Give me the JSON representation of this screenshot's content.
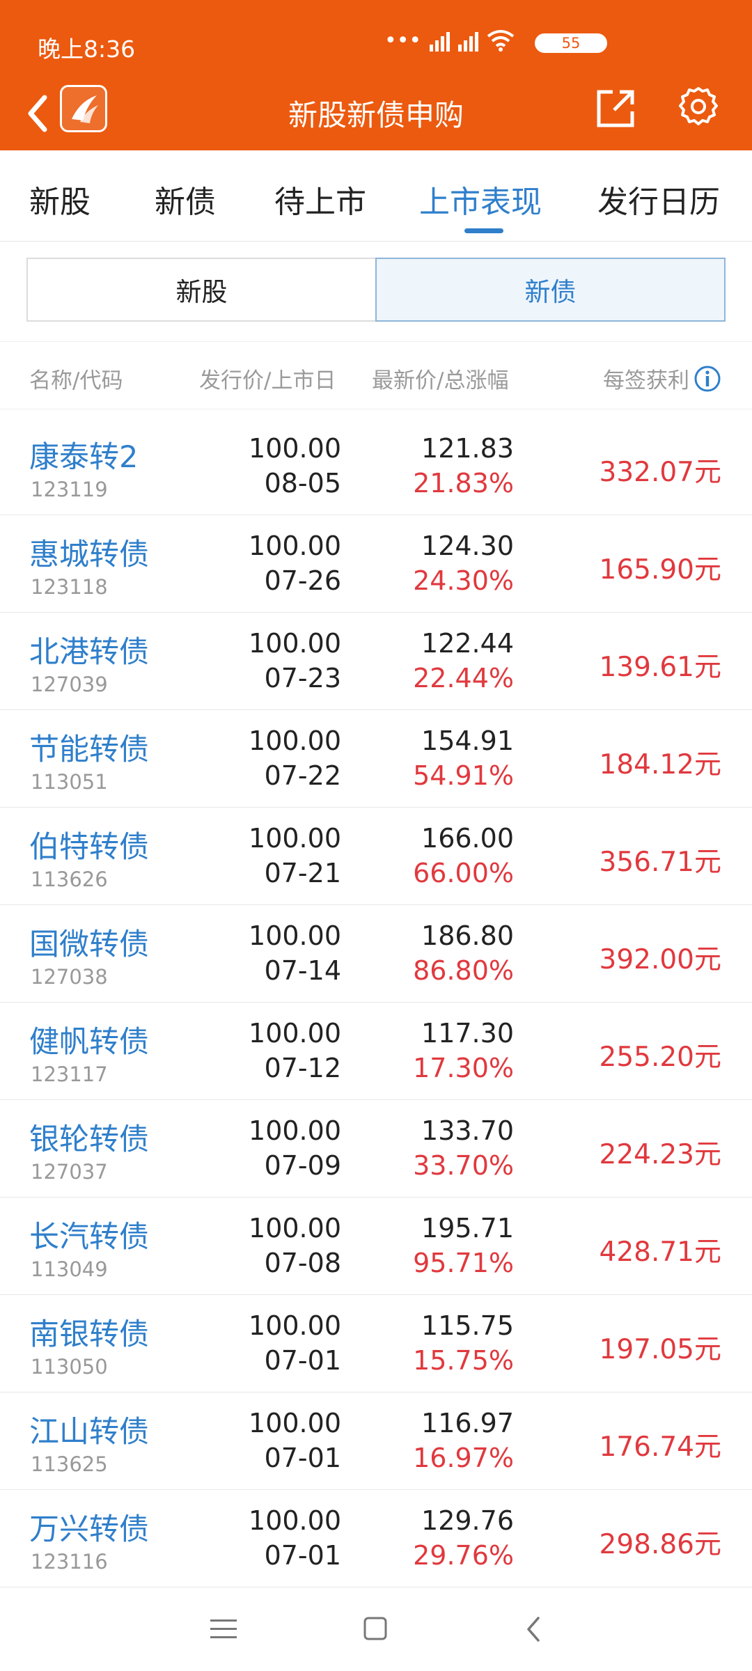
{
  "status_bar": {
    "time": "晚上8:36",
    "battery": "55"
  },
  "header": {
    "title": "新股新债申购"
  },
  "tabs": [
    {
      "label": "新股"
    },
    {
      "label": "新债"
    },
    {
      "label": "待上市"
    },
    {
      "label": "上市表现",
      "active": true
    },
    {
      "label": "发行日历"
    }
  ],
  "segment": {
    "left_label": "新股",
    "right_label": "新债",
    "selected": "新债"
  },
  "columns": {
    "name_code": "名称/代码",
    "issue_date": "发行价/上市日",
    "price_change": "最新价/总涨幅",
    "profit": "每签获利"
  },
  "rows": [
    {
      "name": "康泰转2",
      "code": "123119",
      "issue": "100.00",
      "date": "08-05",
      "price": "121.83",
      "change": "21.83%",
      "profit": "332.07元"
    },
    {
      "name": "惠城转债",
      "code": "123118",
      "issue": "100.00",
      "date": "07-26",
      "price": "124.30",
      "change": "24.30%",
      "profit": "165.90元"
    },
    {
      "name": "北港转债",
      "code": "127039",
      "issue": "100.00",
      "date": "07-23",
      "price": "122.44",
      "change": "22.44%",
      "profit": "139.61元"
    },
    {
      "name": "节能转债",
      "code": "113051",
      "issue": "100.00",
      "date": "07-22",
      "price": "154.91",
      "change": "54.91%",
      "profit": "184.12元"
    },
    {
      "name": "伯特转债",
      "code": "113626",
      "issue": "100.00",
      "date": "07-21",
      "price": "166.00",
      "change": "66.00%",
      "profit": "356.71元"
    },
    {
      "name": "国微转债",
      "code": "127038",
      "issue": "100.00",
      "date": "07-14",
      "price": "186.80",
      "change": "86.80%",
      "profit": "392.00元"
    },
    {
      "name": "健帆转债",
      "code": "123117",
      "issue": "100.00",
      "date": "07-12",
      "price": "117.30",
      "change": "17.30%",
      "profit": "255.20元"
    },
    {
      "name": "银轮转债",
      "code": "127037",
      "issue": "100.00",
      "date": "07-09",
      "price": "133.70",
      "change": "33.70%",
      "profit": "224.23元"
    },
    {
      "name": "长汽转债",
      "code": "113049",
      "issue": "100.00",
      "date": "07-08",
      "price": "195.71",
      "change": "95.71%",
      "profit": "428.71元"
    },
    {
      "name": "南银转债",
      "code": "113050",
      "issue": "100.00",
      "date": "07-01",
      "price": "115.75",
      "change": "15.75%",
      "profit": "197.05元"
    },
    {
      "name": "江山转债",
      "code": "113625",
      "issue": "100.00",
      "date": "07-01",
      "price": "116.97",
      "change": "16.97%",
      "profit": "176.74元"
    },
    {
      "name": "万兴转债",
      "code": "123116",
      "issue": "100.00",
      "date": "07-01",
      "price": "129.76",
      "change": "29.76%",
      "profit": "298.86元"
    }
  ],
  "colors": {
    "brand": "#EC5A0F",
    "accent": "#2F7FCB",
    "up": "#E0393E"
  }
}
